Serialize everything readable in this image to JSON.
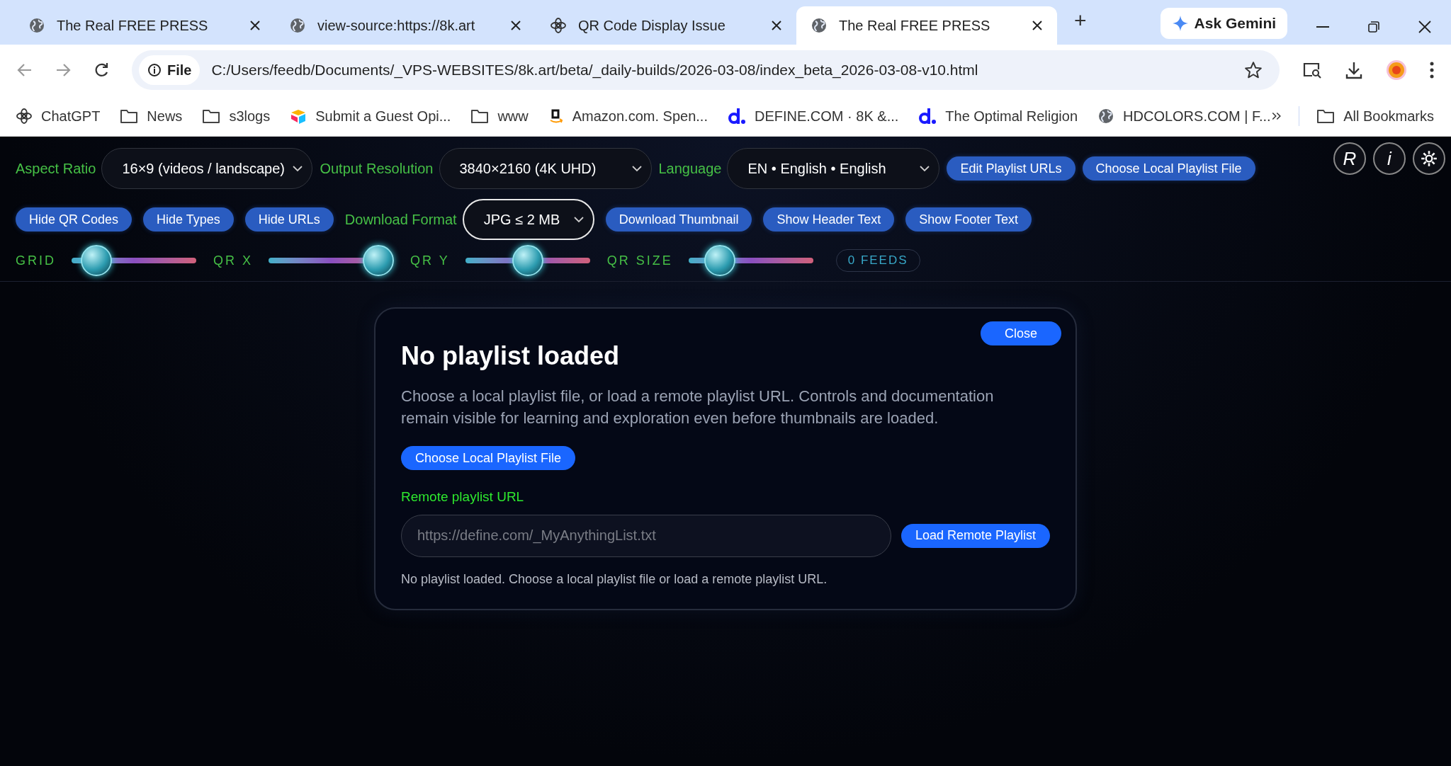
{
  "browser": {
    "tabs": [
      {
        "title": "The Real FREE PRESS",
        "kind": "globe",
        "selected": false
      },
      {
        "title": "view-source:https://8k.art",
        "kind": "globe",
        "selected": false
      },
      {
        "title": "QR Code Display Issue",
        "kind": "chatgpt",
        "selected": false
      },
      {
        "title": "The Real FREE PRESS",
        "kind": "globe",
        "selected": true
      }
    ],
    "new_tab": "+",
    "gemini": "Ask Gemini",
    "address": {
      "scheme": "File",
      "url": "C:/Users/feedb/Documents/_VPS-WEBSITES/8k.art/beta/_daily-builds/2026-03-08/index_beta_2026-03-08-v10.html"
    },
    "bookmarks": [
      {
        "label": "ChatGPT",
        "kind": "chatgpt"
      },
      {
        "label": "News",
        "kind": "folder"
      },
      {
        "label": "s3logs",
        "kind": "folder"
      },
      {
        "label": "Submit a Guest Opi...",
        "kind": "cube"
      },
      {
        "label": "www",
        "kind": "folder"
      },
      {
        "label": "Amazon.com. Spen...",
        "kind": "amazon"
      },
      {
        "label": "DEFINE.COM · 8K &...",
        "kind": "d"
      },
      {
        "label": "The Optimal Religion",
        "kind": "d"
      },
      {
        "label": "HDCOLORS.COM | F...",
        "kind": "globe"
      }
    ],
    "all_bookmarks": "All Bookmarks"
  },
  "app": {
    "row1": [
      {
        "kind": "select",
        "label": "Aspect Ratio",
        "value": "16×9 (videos / landscape)"
      },
      {
        "kind": "select",
        "label": "Output Resolution",
        "value": "3840×2160 (4K UHD)"
      },
      {
        "kind": "select",
        "label": "Language",
        "value": "EN • English • English"
      },
      {
        "kind": "button",
        "text": "Edit Playlist URLs"
      },
      {
        "kind": "button",
        "text": "Choose Local Playlist File"
      }
    ],
    "corner_buttons": [
      "R",
      "i"
    ],
    "row2": [
      {
        "kind": "button",
        "text": "Hide QR Codes"
      },
      {
        "kind": "button",
        "text": "Hide Types"
      },
      {
        "kind": "button",
        "text": "Hide URLs"
      },
      {
        "kind": "select",
        "label": "Download Format",
        "value": "JPG ≤ 2 MB",
        "focused": true
      },
      {
        "kind": "button",
        "text": "Download Thumbnail"
      },
      {
        "kind": "button",
        "text": "Show Header Text"
      },
      {
        "kind": "button",
        "text": "Show Footer Text"
      }
    ],
    "sliders": [
      {
        "label": "GRID",
        "level": 0.2
      },
      {
        "label": "QR X",
        "level": 0.88
      },
      {
        "label": "QR Y",
        "level": 0.5
      },
      {
        "label": "QR SIZE",
        "level": 0.25
      }
    ],
    "feeds": "0 FEEDS",
    "dialog": {
      "close": "Close",
      "title": "No playlist loaded",
      "text": "Choose a local playlist file, or load a remote playlist URL. Controls and documentation remain visible for learning and exploration even before thumbnails are loaded.",
      "choose_button": "Choose Local Playlist File",
      "url_label": "Remote playlist URL",
      "url_placeholder": "https://define.com/_MyAnythingList.txt",
      "load_button": "Load Remote Playlist",
      "status": "No playlist loaded. Choose a local playlist file or load a remote playlist URL."
    }
  }
}
